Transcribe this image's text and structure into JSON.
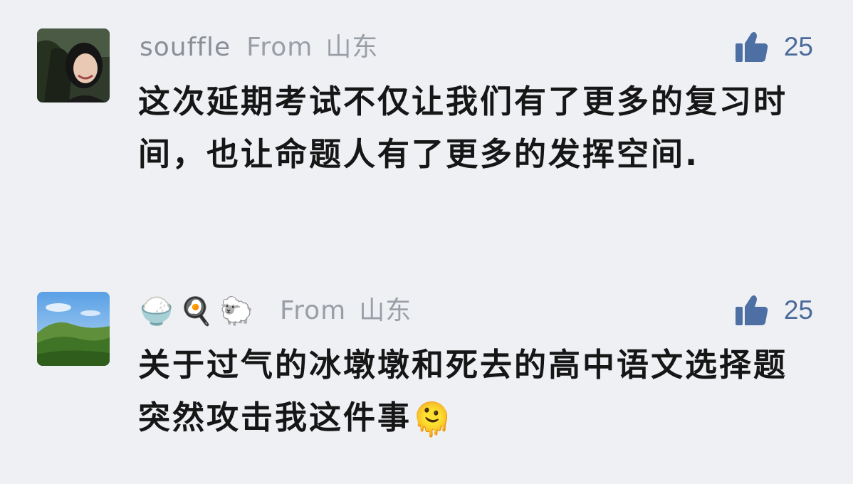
{
  "comments": [
    {
      "username": "souffle",
      "from_label": "From",
      "location": "山东",
      "likes": "25",
      "text": "这次延期考试不仅让我们有了更多的复习时间，也让命题人有了更多的发挥空间."
    },
    {
      "username_emojis": [
        "🍚",
        "🍳",
        "🐑"
      ],
      "from_label": "From",
      "location": "山东",
      "likes": "25",
      "text": "关于过气的冰墩墩和死去的高中语文选择题突然攻击我这件事",
      "trailing_emoji": "🫠"
    }
  ],
  "icons": {
    "like": "thumbs-up-icon"
  },
  "colors": {
    "background": "#eef0f4",
    "like_icon": "#4d6fa3",
    "meta_text": "#8f939b",
    "body_text": "#161616"
  }
}
